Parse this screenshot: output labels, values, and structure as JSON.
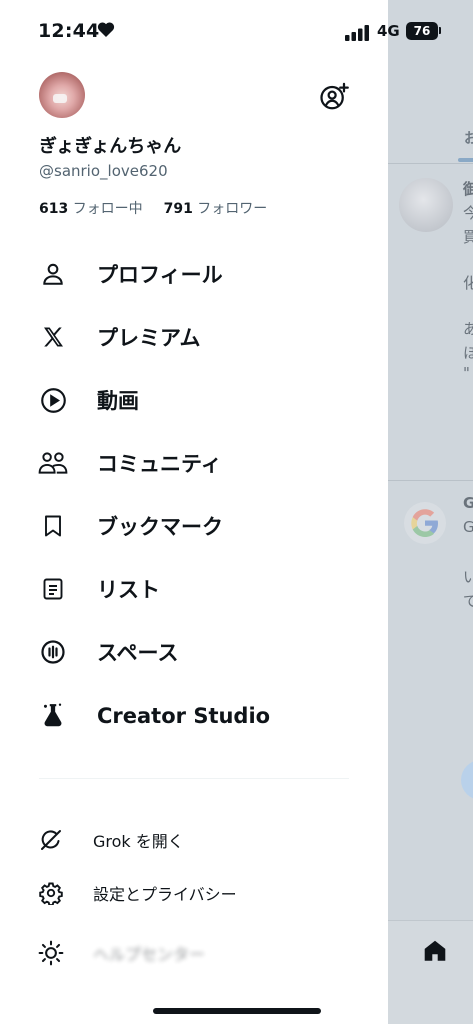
{
  "status_bar": {
    "time": "12:44",
    "network": "4G",
    "battery": "76"
  },
  "profile": {
    "display_name": "ぎょぎょんちゃん",
    "handle": "@sanrio_love620",
    "following_count": "613",
    "following_label": "フォロー中",
    "followers_count": "791",
    "followers_label": "フォロワー"
  },
  "menu": [
    {
      "label": "プロフィール",
      "icon": "person-icon"
    },
    {
      "label": "プレミアム",
      "icon": "x-logo-icon"
    },
    {
      "label": "動画",
      "icon": "play-circle-icon"
    },
    {
      "label": "コミュニティ",
      "icon": "people-icon"
    },
    {
      "label": "ブックマーク",
      "icon": "bookmark-icon"
    },
    {
      "label": "リスト",
      "icon": "list-icon"
    },
    {
      "label": "スペース",
      "icon": "spaces-icon"
    },
    {
      "label": "Creator Studio",
      "icon": "flask-icon"
    }
  ],
  "secondary": [
    {
      "label": "Grok を開く",
      "icon": "grok-icon"
    },
    {
      "label": "設定とプライバシー",
      "icon": "gear-icon"
    },
    {
      "label": "ヘルプセンター",
      "icon": "sun-icon"
    }
  ],
  "background": {
    "tab_label": "お",
    "post1_lines": [
      "御",
      "今",
      "買",
      "化",
      "あ",
      "ほ",
      "\""
    ],
    "post2_lines": [
      "G",
      "G",
      "い",
      "で"
    ]
  },
  "colors": {
    "text": "#0f1419",
    "secondary_text": "#536471",
    "overlay": "#cfd6dc"
  }
}
